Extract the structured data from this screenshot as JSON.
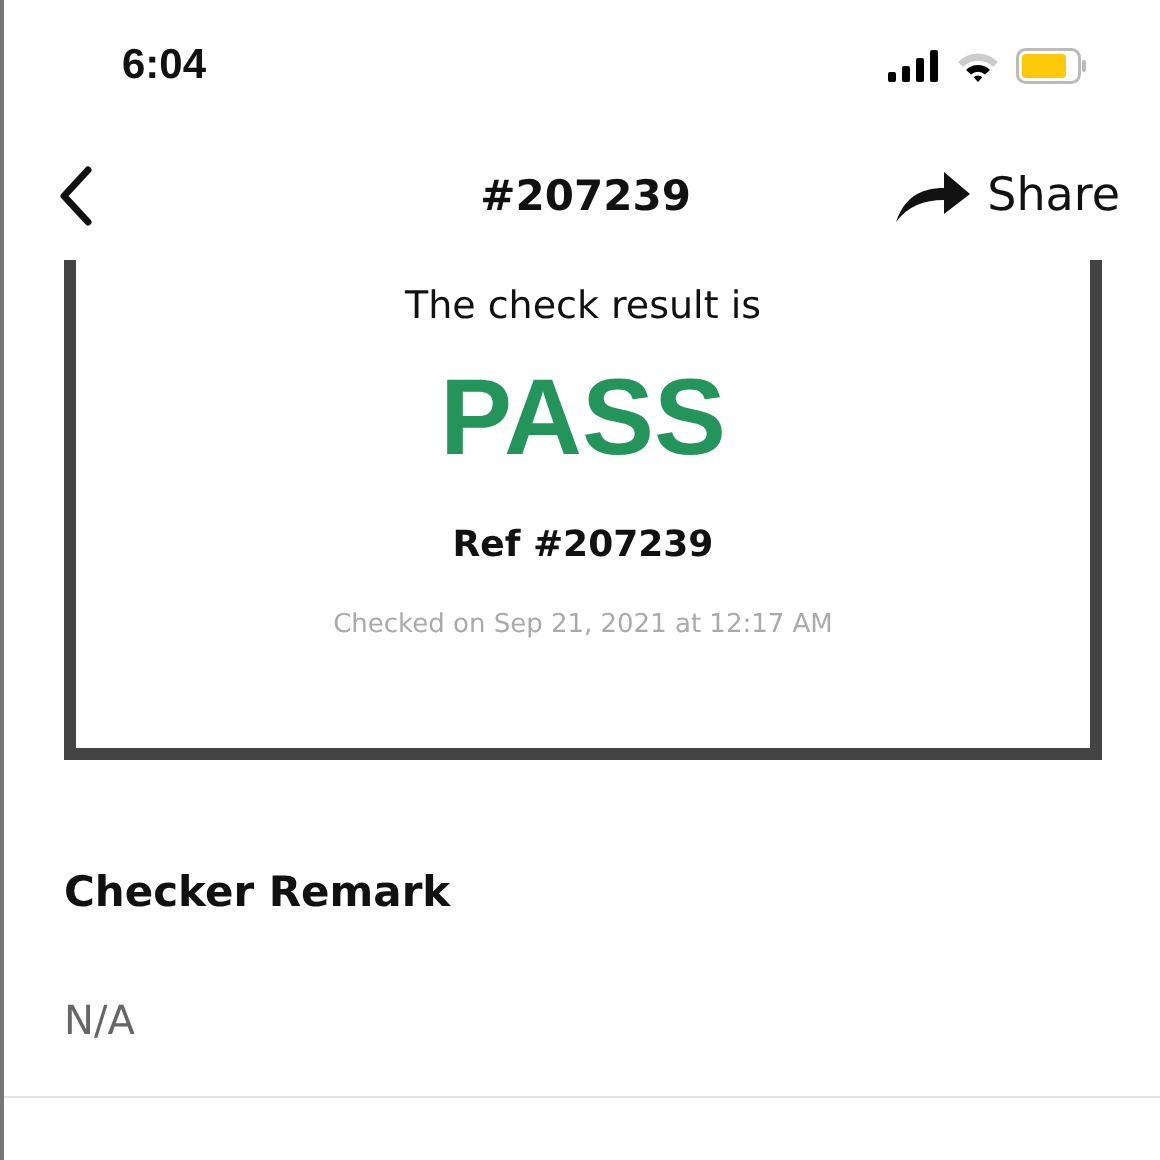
{
  "status_bar": {
    "time": "6:04"
  },
  "nav": {
    "title": "#207239",
    "share_label": "Share"
  },
  "result_card": {
    "intro": "The check result is",
    "result": "PASS",
    "reference": "Ref #207239",
    "checked_on": "Checked on Sep 21, 2021 at 12:17 AM"
  },
  "remark": {
    "heading": "Checker Remark",
    "value": "N/A"
  }
}
